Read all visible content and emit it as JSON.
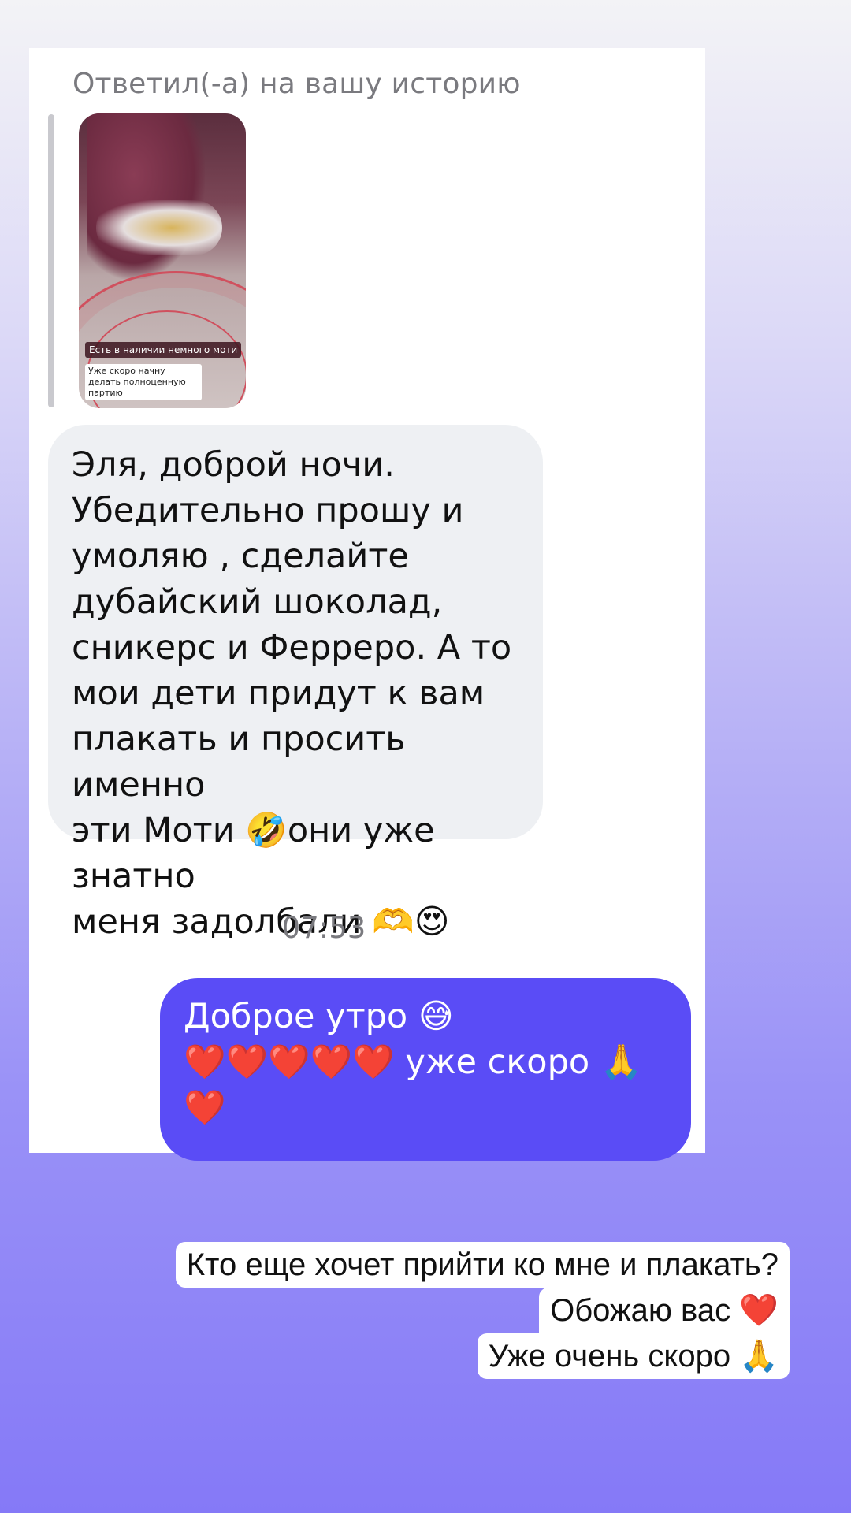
{
  "reply": {
    "label": "Ответил(-а) на вашу историю",
    "story_caption_1": "Есть в наличии немного моти",
    "story_caption_2": "Уже скоро начну делать полноценную партию"
  },
  "messages": {
    "incoming_text": "Эля, доброй ночи.\nУбедительно прошу и\nумоляю , сделайте\nдубайский шоколад,\nсникерс и Ферреро. А то\nмои дети придут к вам\nплакать и просить именно\nэти Моти 🤣они уже знатно\nменя задолбали 🫶😍",
    "timestamp": "07:53",
    "outgoing_text": "Доброе утро 😅\n❤️❤️❤️❤️❤️ уже скоро 🙏\n❤️"
  },
  "overlay_text": {
    "line1": "Кто еще хочет прийти ко мне и плакать?",
    "line2": "Обожаю вас ❤️",
    "line3": "Уже очень скоро 🙏"
  },
  "colors": {
    "outgoing_bubble": "#5a4cf6",
    "incoming_bubble": "#eef0f3",
    "background_bottom": "#8579f7"
  }
}
